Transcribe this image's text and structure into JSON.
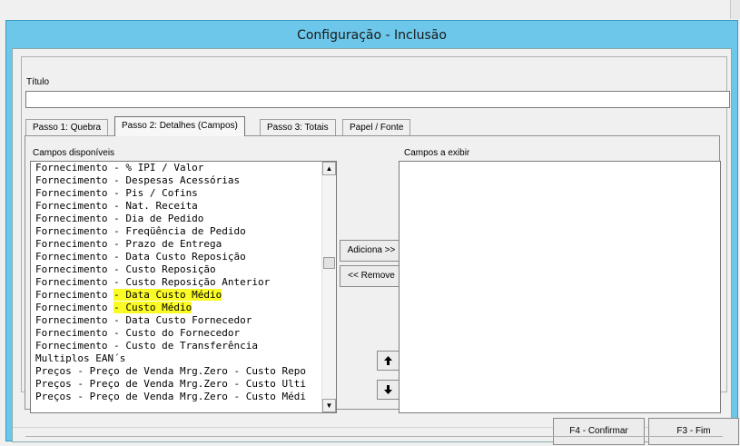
{
  "window": {
    "title": "Configuração - Inclusão"
  },
  "titulo": {
    "label": "Título",
    "value": ""
  },
  "tabs": [
    {
      "label": "Passo 1: Quebra"
    },
    {
      "label": "Passo 2: Detalhes (Campos)"
    },
    {
      "label": "Passo 3: Totais"
    },
    {
      "label": "Papel / Fonte"
    }
  ],
  "available": {
    "label": "Campos disponíveis",
    "items": [
      {
        "text": "Fornecimento - % IPI / Valor",
        "highlight": ""
      },
      {
        "text": "Fornecimento - Despesas Acessórias",
        "highlight": ""
      },
      {
        "text": "Fornecimento - Pis / Cofins",
        "highlight": ""
      },
      {
        "text": "Fornecimento - Nat. Receita",
        "highlight": ""
      },
      {
        "text": "Fornecimento - Dia de Pedido",
        "highlight": ""
      },
      {
        "text": "Fornecimento - Freqüência de Pedido",
        "highlight": ""
      },
      {
        "text": "Fornecimento - Prazo de Entrega",
        "highlight": ""
      },
      {
        "text": "Fornecimento - Data Custo Reposição",
        "highlight": ""
      },
      {
        "text": "Fornecimento - Custo Reposição",
        "highlight": ""
      },
      {
        "text": "Fornecimento - Custo Reposição Anterior",
        "highlight": ""
      },
      {
        "text": "Fornecimento - Data Custo Médio",
        "highlight": "- Data Custo Médio"
      },
      {
        "text": "Fornecimento - Custo Médio",
        "highlight": "- Custo Médio"
      },
      {
        "text": "Fornecimento - Data Custo Fornecedor",
        "highlight": ""
      },
      {
        "text": "Fornecimento - Custo do Fornecedor",
        "highlight": ""
      },
      {
        "text": "Fornecimento - Custo de Transferência",
        "highlight": ""
      },
      {
        "text": "Multiplos EAN´s",
        "highlight": ""
      },
      {
        "text": "Preços - Preço de Venda Mrg.Zero - Custo Repo",
        "highlight": ""
      },
      {
        "text": "Preços - Preço de Venda Mrg.Zero - Custo Ulti",
        "highlight": ""
      },
      {
        "text": "Preços - Preço de Venda Mrg.Zero - Custo Médi",
        "highlight": ""
      }
    ]
  },
  "selected": {
    "label": "Campos a exibir",
    "items": []
  },
  "buttons": {
    "add": "Adiciona >>",
    "remove": "<< Remove",
    "confirm": "F4 - Confirmar",
    "end": "F3 - Fim"
  },
  "icons": {
    "move_up": "arrow-up-icon",
    "move_down": "arrow-down-icon",
    "scroll_up": "scroll-up-icon",
    "scroll_down": "scroll-down-icon"
  },
  "colors": {
    "titlebar": "#6cc7ea",
    "highlight": "#fbfb26"
  }
}
